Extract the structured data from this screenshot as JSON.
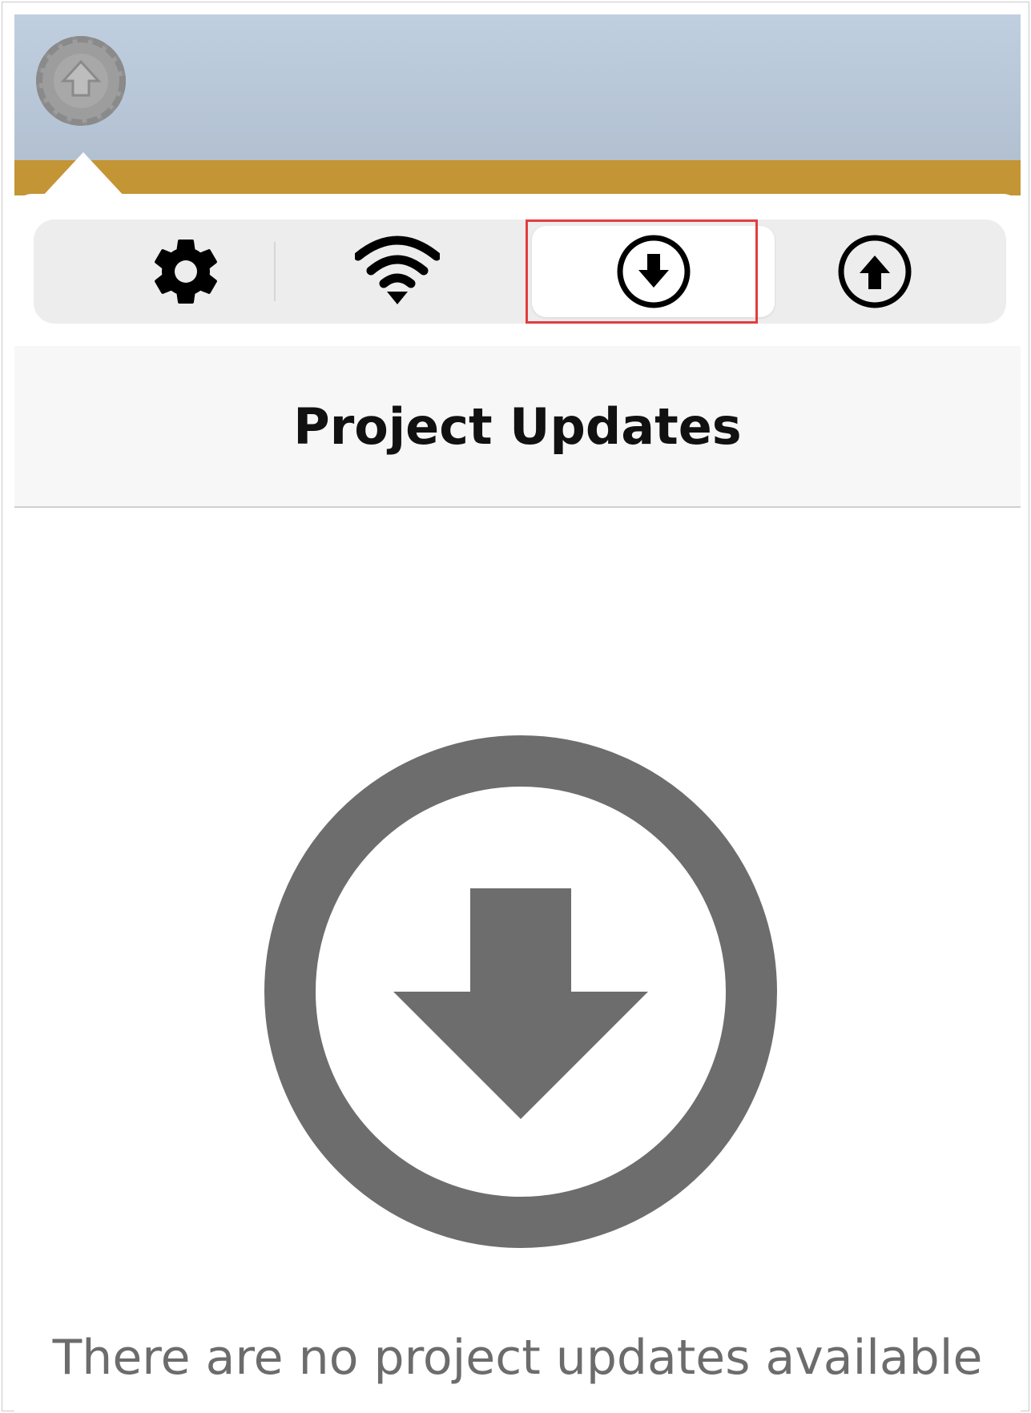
{
  "colors": {
    "header_blue": "#b8c6d6",
    "header_gold": "#c39535",
    "segment_bg": "#ededed",
    "selected_segment_bg": "#ffffff",
    "highlight_red": "#e43c3c",
    "empty_icon_gray": "#6d6d6d",
    "message_gray": "#6c6c6c"
  },
  "header": {
    "app_icon": "circular-arrow-app-icon"
  },
  "tabs": [
    {
      "id": "settings",
      "icon": "gear-icon",
      "selected": false
    },
    {
      "id": "connectivity",
      "icon": "wifi-icon",
      "selected": false
    },
    {
      "id": "downloads",
      "icon": "download-circle-icon",
      "selected": true
    },
    {
      "id": "uploads",
      "icon": "upload-circle-icon",
      "selected": false
    }
  ],
  "page": {
    "title": "Project Updates"
  },
  "empty_state": {
    "icon": "download-circle-icon",
    "message": "There are no project updates available"
  }
}
